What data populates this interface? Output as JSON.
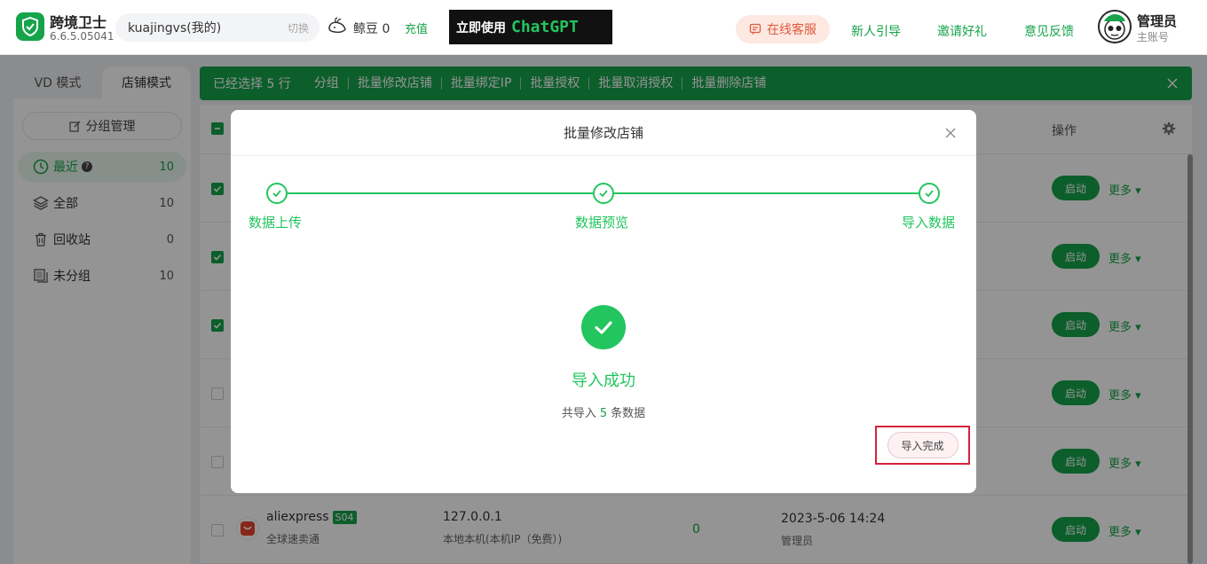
{
  "header": {
    "app_name": "跨境卫士",
    "version": "6.6.5.05041",
    "account": "kuajingvs(我的)",
    "switch_label": "切换",
    "beans_label": "鲸豆 0",
    "recharge": "充值",
    "ad_text1": "立即使用",
    "ad_text2": "ChatGPT",
    "service": "在线客服",
    "links": [
      "新人引导",
      "邀请好礼",
      "意见反馈"
    ],
    "user_name": "管理员",
    "user_role": "主账号"
  },
  "sidebar": {
    "tabs": [
      "VD 模式",
      "店铺模式"
    ],
    "group_manage": "分组管理",
    "items": [
      {
        "label": "最近",
        "count": "10"
      },
      {
        "label": "全部",
        "count": "10"
      },
      {
        "label": "回收站",
        "count": "0"
      },
      {
        "label": "未分组",
        "count": "10"
      }
    ]
  },
  "action_bar": {
    "selected": "已经选择 5 行",
    "actions": [
      "分组",
      "批量修改店铺",
      "批量绑定IP",
      "批量授权",
      "批量取消授权",
      "批量删除店铺"
    ]
  },
  "table": {
    "op_header": "操作",
    "start_label": "启动",
    "more_label": "更多",
    "last_row": {
      "store": "aliexpress",
      "tag": "S04",
      "store_sub": "全球速卖通",
      "ip": "127.0.0.1",
      "ip_sub": "本地本机(本机IP（免费）)",
      "count": "0",
      "date": "2023-5-06 14:24",
      "creator": "管理员"
    }
  },
  "modal": {
    "title": "批量修改店铺",
    "steps": [
      "数据上传",
      "数据预览",
      "导入数据"
    ],
    "success_title": "导入成功",
    "success_prefix": "共导入",
    "success_count": "5",
    "success_suffix": "条数据",
    "finish": "导入完成"
  },
  "colors": {
    "primary": "#16a34a",
    "success": "#22c55e",
    "highlight": "#d6223a"
  }
}
